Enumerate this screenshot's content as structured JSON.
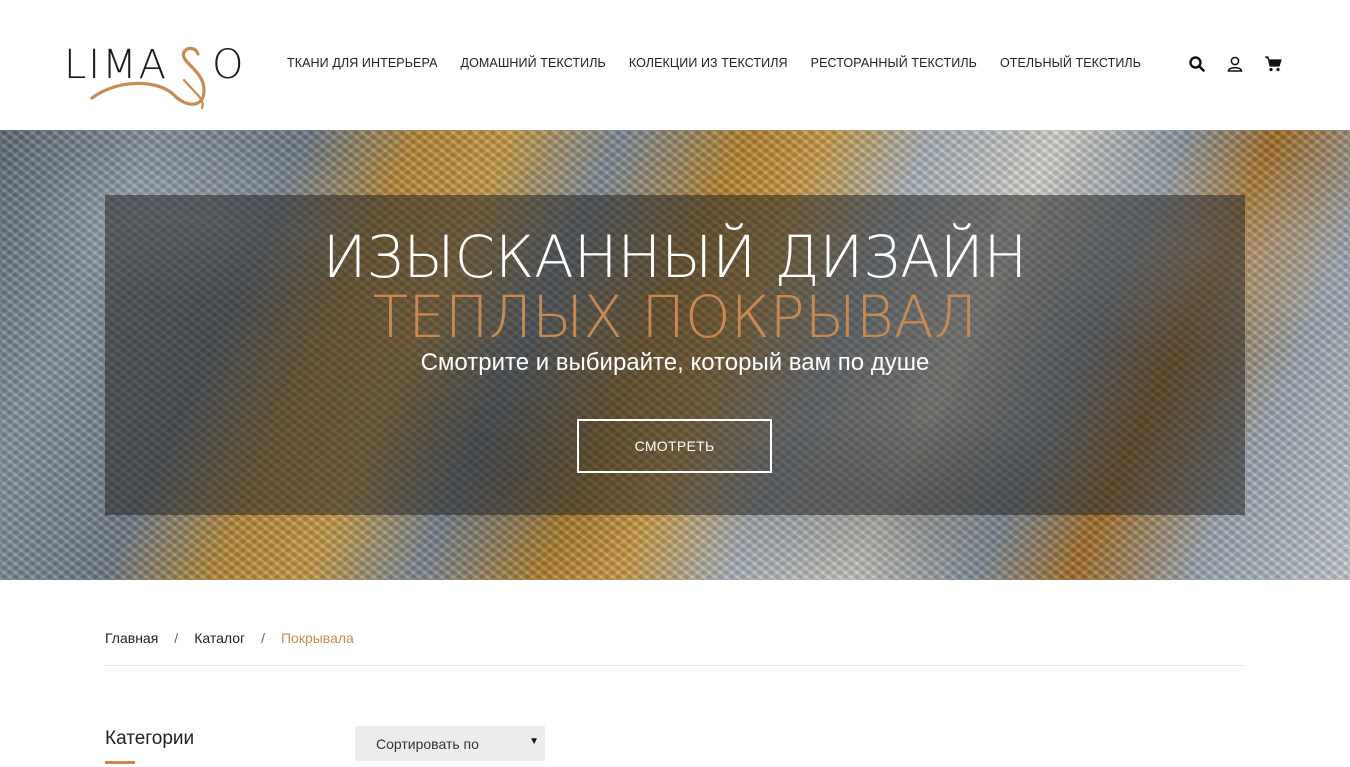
{
  "header": {
    "logo_text": "LIMASO",
    "nav": [
      {
        "label": "Ткани для интерьера"
      },
      {
        "label": "Домашний текстиль"
      },
      {
        "label": "Колекции из текстиля"
      },
      {
        "label": "Ресторанный текстиль"
      },
      {
        "label": "Отельный текстиль"
      }
    ],
    "icons": [
      "search-icon",
      "user-icon",
      "cart-icon"
    ]
  },
  "hero": {
    "title_line1": "ИЗЫСКАННЫЙ ДИЗАЙН",
    "title_line2": "ТЕПЛЫХ ПОКРЫВАЛ",
    "subtitle": "Смотрите и выбирайте, который вам по душе",
    "button_label": "Смотреть"
  },
  "breadcrumb": {
    "items": [
      "Главная",
      "Каталог"
    ],
    "separator": "/",
    "current": "Покрывала"
  },
  "sidebar": {
    "title": "Категории"
  },
  "sort": {
    "label": "Сортировать по"
  },
  "colors": {
    "accent": "#c98a52",
    "text": "#222222",
    "select_bg": "#ececec"
  }
}
